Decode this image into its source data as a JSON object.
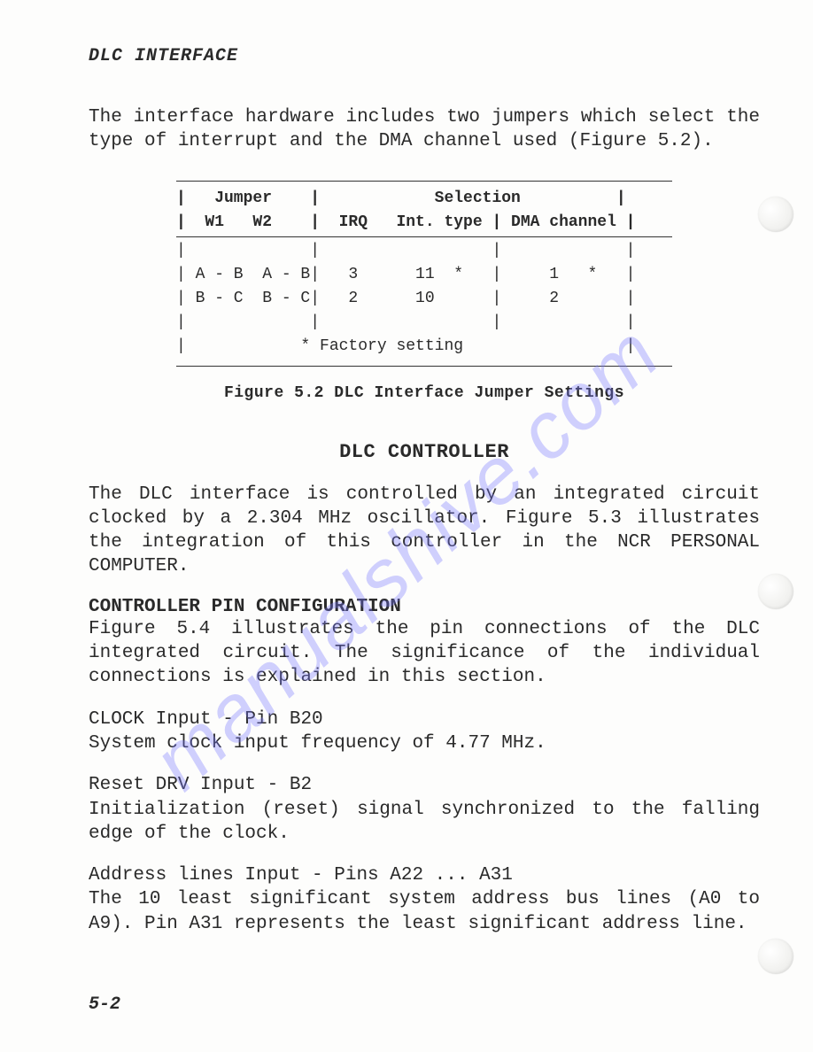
{
  "header": "DLC INTERFACE",
  "intro_para": "The interface hardware includes two jumpers which select the type of interrupt and the DMA channel used (Figure 5.2).",
  "table": {
    "header_row1": "|   Jumper    |            Selection          |",
    "header_row2": "|  W1   W2    |  IRQ   Int. type | DMA channel |",
    "blankrow": "|             |                  |             |",
    "row1": "| A - B  A - B|   3      11  *   |     1   *   |",
    "row2": "| B - C  B - C|   2      10      |     2       |",
    "blankrow2": "|             |                  |             |",
    "footnote": "|            * Factory setting                 |"
  },
  "caption": "Figure 5.2  DLC Interface Jumper Settings",
  "section_title": "DLC CONTROLLER",
  "controller_para": "The DLC interface is controlled by an integrated circuit clocked by a 2.304 MHz oscillator. Figure 5.3 illustrates the integration of this controller in the NCR PERSONAL COMPUTER.",
  "pinconfig_title": "CONTROLLER PIN CONFIGURATION",
  "pinconfig_para": "Figure 5.4 illustrates the pin connections of the DLC integrated circuit. The significance of the individual connections is explained in this section.",
  "clock_head": "CLOCK Input - Pin B20",
  "clock_body": "System clock input frequency of 4.77 MHz.",
  "reset_head": "Reset DRV Input - B2",
  "reset_body": "Initialization (reset) signal synchronized to the falling edge of the clock.",
  "addr_head": "Address lines Input - Pins A22 ... A31",
  "addr_body": "The 10 least significant system address bus lines (A0 to A9). Pin A31 represents the least significant address line.",
  "page_num": "5-2",
  "watermark": "manualshive.com"
}
